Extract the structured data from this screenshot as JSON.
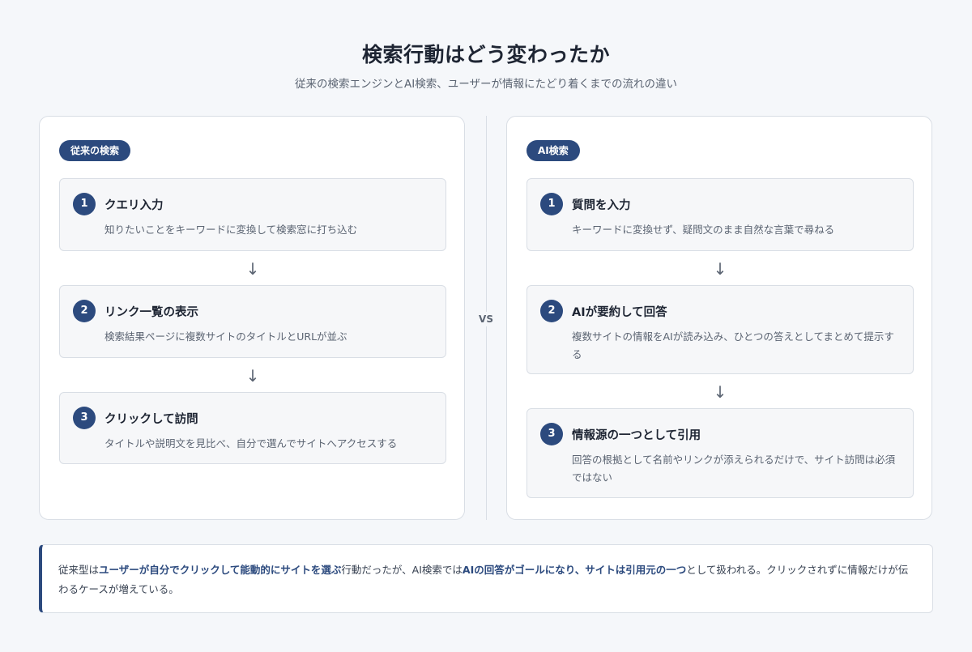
{
  "header": {
    "title": "検索行動はどう変わったか",
    "subtitle": "従来の検索エンジンとAI検索、ユーザーが情報にたどり着くまでの流れの違い"
  },
  "left": {
    "label": "従来の検索",
    "steps": [
      {
        "num": "1",
        "title": "クエリ入力",
        "desc": "知りたいことをキーワードに変換して検索窓に打ち込む"
      },
      {
        "num": "2",
        "title": "リンク一覧の表示",
        "desc": "検索結果ページに複数サイトのタイトルとURLが並ぶ"
      },
      {
        "num": "3",
        "title": "クリックして訪問",
        "desc": "タイトルや説明文を見比べ、自分で選んでサイトへアクセスする"
      }
    ]
  },
  "right": {
    "label": "AI検索",
    "steps": [
      {
        "num": "1",
        "title": "質問を入力",
        "desc": "キーワードに変換せず、疑問文のまま自然な言葉で尋ねる"
      },
      {
        "num": "2",
        "title": "AIが要約して回答",
        "desc": "複数サイトの情報をAIが読み込み、ひとつの答えとしてまとめて提示する"
      },
      {
        "num": "3",
        "title": "情報源の一つとして引用",
        "desc": "回答の根拠として名前やリンクが添えられるだけで、サイト訪問は必須ではない"
      }
    ]
  },
  "arrow_glyph": "↓",
  "vs_label": "VS",
  "summary": {
    "p1": "従来型は",
    "h1": "ユーザーが自分でクリックして能動的にサイトを選ぶ",
    "p2": "行動だったが、AI検索では",
    "h2": "AIの回答がゴールになり、サイトは引用元の一つ",
    "p3": "として扱われる。クリックされずに情報だけが伝わるケースが増えている。"
  },
  "colors": {
    "accent": "#2c4a7e",
    "background": "#f5f7fa",
    "card": "#ffffff",
    "step_bg": "#f6f7f9",
    "border": "#d9dee5",
    "muted_text": "#5b6472"
  }
}
